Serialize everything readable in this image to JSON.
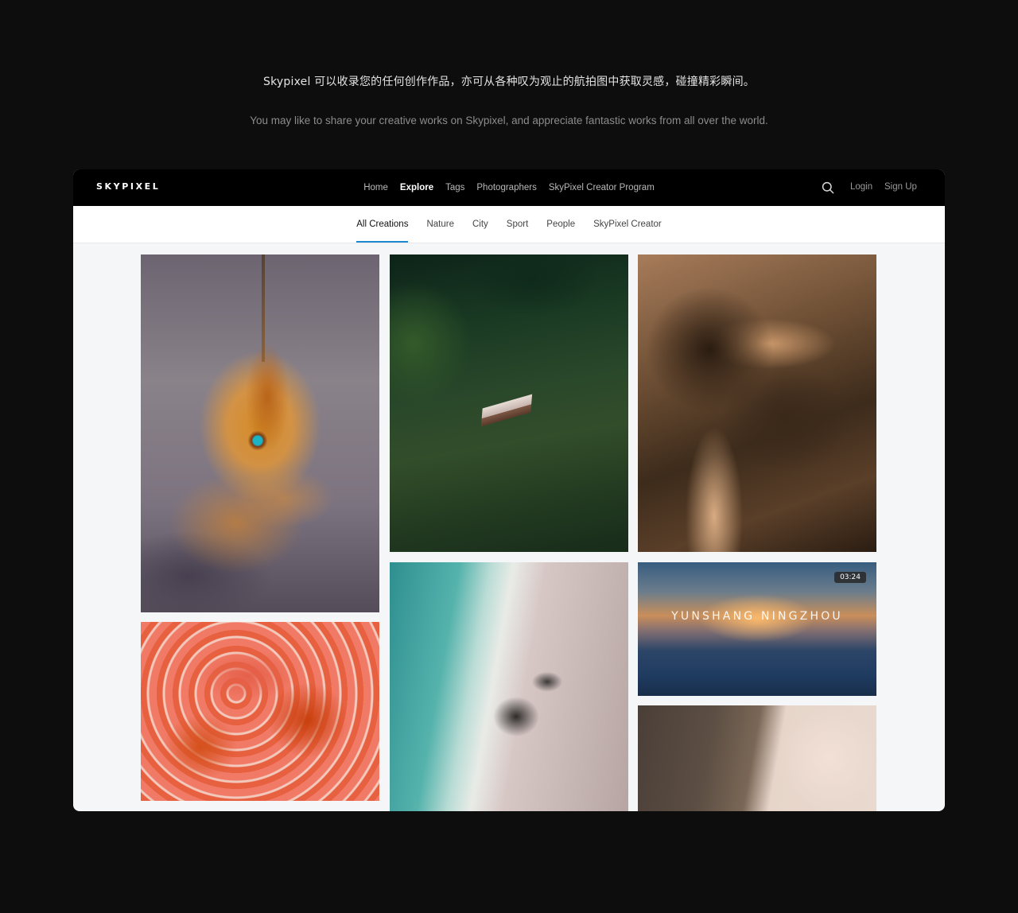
{
  "intro": {
    "cn": "Skypixel 可以收录您的任何创作作品，亦可从各种叹为观止的航拍图中获取灵感，碰撞精彩瞬间。",
    "en": "You may like to share your creative works on Skypixel, and appreciate fantastic works from all over the world."
  },
  "header": {
    "logo": "SKYPIXEL",
    "nav": [
      "Home",
      "Explore",
      "Tags",
      "Photographers",
      "SkyPixel Creator Program"
    ],
    "active_nav": "Explore",
    "search_icon": "search-icon",
    "login": "Login",
    "signup": "Sign Up"
  },
  "subnav": {
    "tabs": [
      "All Creations",
      "Nature",
      "City",
      "Sport",
      "People",
      "SkyPixel Creator"
    ],
    "active": "All Creations",
    "accent_color": "#1e88d1"
  },
  "gallery": {
    "video": {
      "duration": "03:24",
      "title": "YUNSHANG NINGZHOU"
    }
  }
}
